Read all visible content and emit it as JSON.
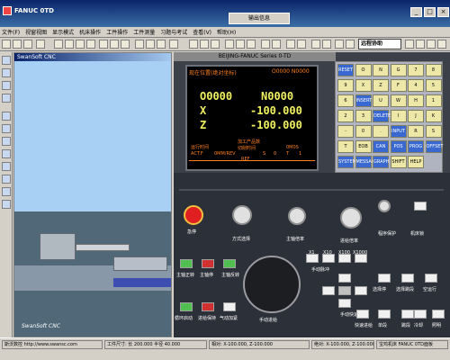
{
  "window": {
    "title": "FANUC 0TD",
    "float_label": "输出信息",
    "min": "_",
    "max": "□",
    "close": "×"
  },
  "menu": [
    "文件(F)",
    "视窗视图",
    "显示模式",
    "机床操作",
    "工件操作",
    "工件测量",
    "习题与考试",
    "查看(V)",
    "帮助(H)"
  ],
  "toolbar_combo": "远程协助",
  "viewer": {
    "caption": "SwanSoft CNC",
    "caption_bottom": "SwanSoft CNC"
  },
  "cnc": {
    "header": "BEIJING-FANUC Series 0-TD",
    "screen_title": "现在位置(绝对坐标)",
    "program_no": "O0000 N0000",
    "row1_l": "O0000",
    "row1_r": "N0000",
    "row2_l": "X",
    "row2_r": "-100.000",
    "row3_l": "Z",
    "row3_r": "-100.000",
    "run_time_label": "运行时间",
    "parts_label": "加工产品数",
    "cut_time_label": "切削时间",
    "cut_time_value": "0M0S",
    "act_label": "ACT.F",
    "act_value": "0MM/REV",
    "s_label": "S",
    "s_value": "0",
    "t_label": "T",
    "t_value": "1",
    "ref_label": "REF",
    "softkey_labels": [
      "",
      "",
      "",
      "",
      ""
    ]
  },
  "keypad": {
    "keys": [
      "RESET",
      "O",
      "N",
      "G",
      "7",
      "8",
      "9",
      "X",
      "Z",
      "F",
      "4",
      "5",
      "6",
      "INSERT",
      "U",
      "W",
      "H",
      "1",
      "2",
      "3",
      "DELETE",
      "I",
      "J",
      "K",
      "-",
      "0",
      ".",
      "INPUT",
      "R",
      "S",
      "T",
      "EOB",
      "CAN",
      "POS",
      "PROG",
      "OFFSET",
      "SYSTEM",
      "MESSAGE",
      "GRAPH",
      "SHIFT",
      "HELP"
    ]
  },
  "controls": {
    "estop": "急停",
    "mode": "方式选择",
    "spindle_override": "主轴倍率",
    "feed_override": "进给倍率",
    "program_protect": "程序保护",
    "machine_lock": "机床锁",
    "spindle_fwd": "主轴正转",
    "spindle_stop": "主轴停",
    "spindle_rev": "主轴反转",
    "manual_pulse": "手动脉冲",
    "x1": "X1",
    "x10": "X10",
    "x100": "X100",
    "x1000": "X1000",
    "cycle_start": "循环启动",
    "feed_hold": "进给保持",
    "air_sample": "气动加紧",
    "handwheel": "手动进给",
    "manual_move": "手动快速",
    "jog": "快速进给",
    "single_block": "单段",
    "skip": "跳段",
    "optional_stop": "选择停",
    "feed_select": "选择跳段",
    "coolant": "冷却",
    "dry_run": "空运行",
    "light": "照明"
  },
  "status": {
    "left": "斯沃数控 http://www.swansc.com",
    "work_size": "工件尺寸: 长 200.000 半径 40.000",
    "abs": "相对: X-100.000, Z-100.000",
    "abs2": "绝对: X-100.000, Z-100.000",
    "machine": "宝鸡机床 FANUC 0TD面板"
  }
}
